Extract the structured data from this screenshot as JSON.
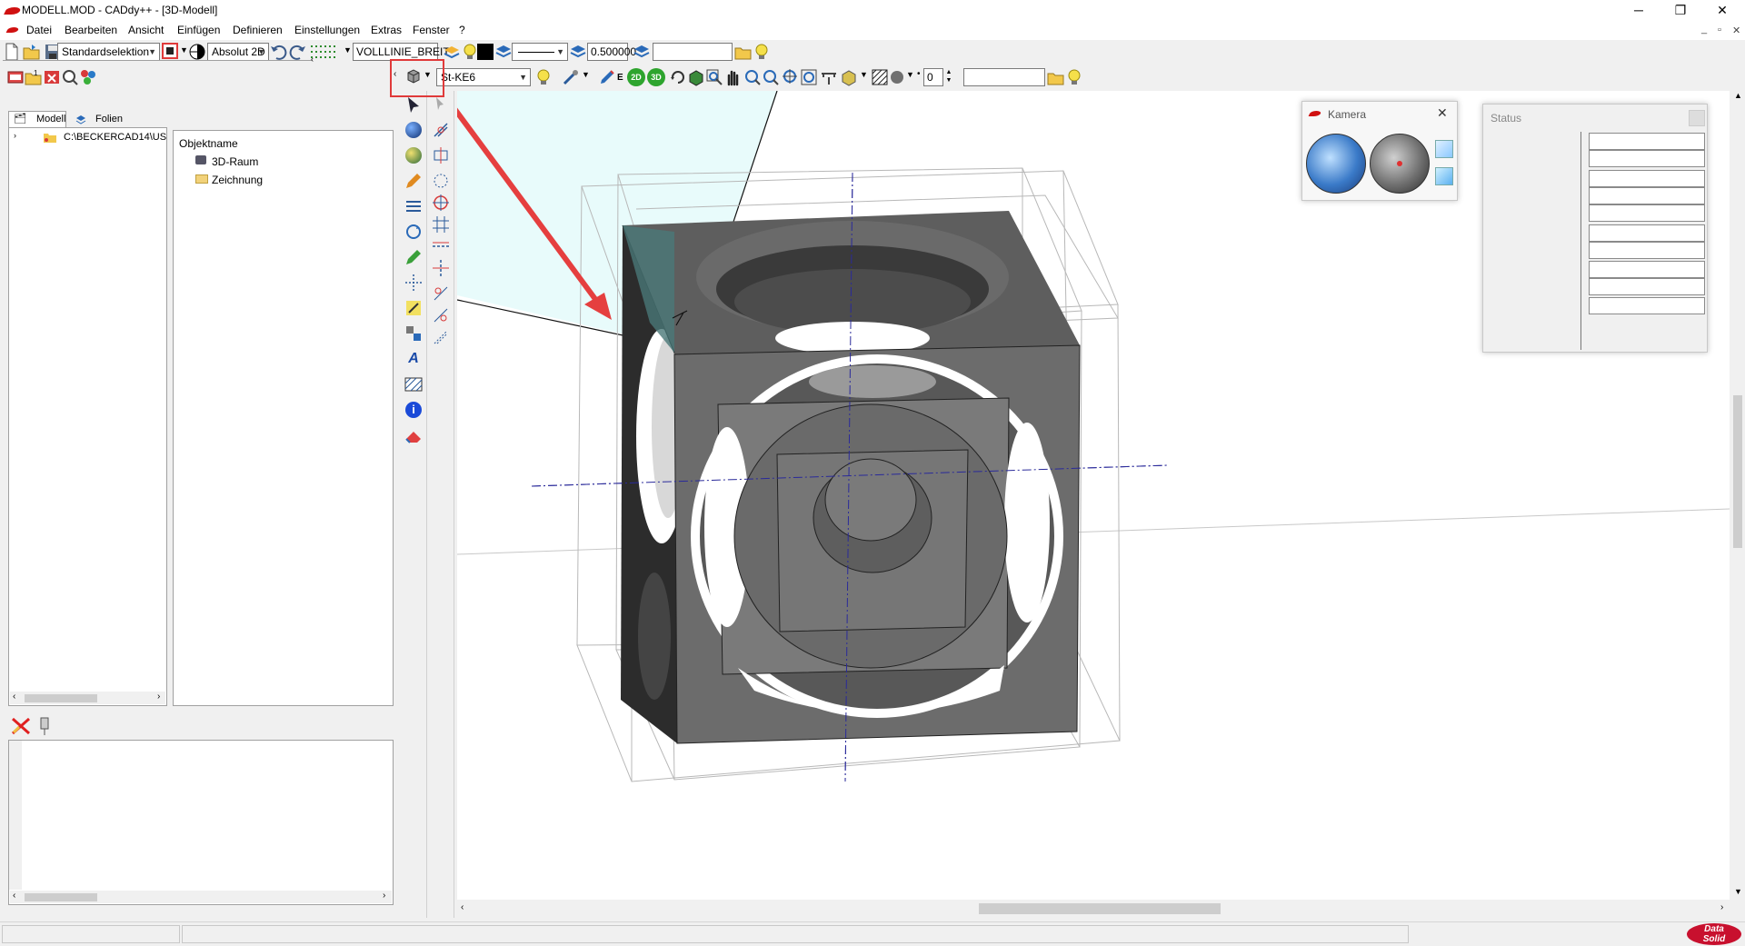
{
  "window": {
    "title": "MODELL.MOD  -  CADdy++ - [3D-Modell]",
    "minimize": "─",
    "restore": "❐",
    "close": "✕",
    "mdi_minimize": "_",
    "mdi_restore": "▫",
    "mdi_close": "✕"
  },
  "menu": [
    "Datei",
    "Bearbeiten",
    "Ansicht",
    "Einfügen",
    "Definieren",
    "Einstellungen",
    "Extras",
    "Fenster",
    "?"
  ],
  "toolbar1": {
    "selection_mode": "Standardselektion",
    "coord_mode": "Absolut 2D",
    "line_type": "VOLLLINIE_BREIT",
    "line_width": "0.500000",
    "layer_value": ""
  },
  "toolbar2": {
    "material": "St-KE6",
    "step_value": "0",
    "search_value": ""
  },
  "left_panel": {
    "tabs": [
      "Modell",
      "Folien"
    ],
    "tree_root": "C:\\BECKERCAD14\\US",
    "list_header": "Objektname",
    "list_items": [
      "3D-Raum",
      "Zeichnung"
    ]
  },
  "camera_window": {
    "title": "Kamera"
  },
  "status_window": {
    "title": "Status"
  },
  "brand": {
    "logo_line1": "Data",
    "logo_line2": "Solid"
  },
  "colors": {
    "accent_red": "#e03a3a",
    "viewport_bg": "#ffffff",
    "model_gray": "#6e6e6e",
    "sky": "#e8fbfb"
  }
}
